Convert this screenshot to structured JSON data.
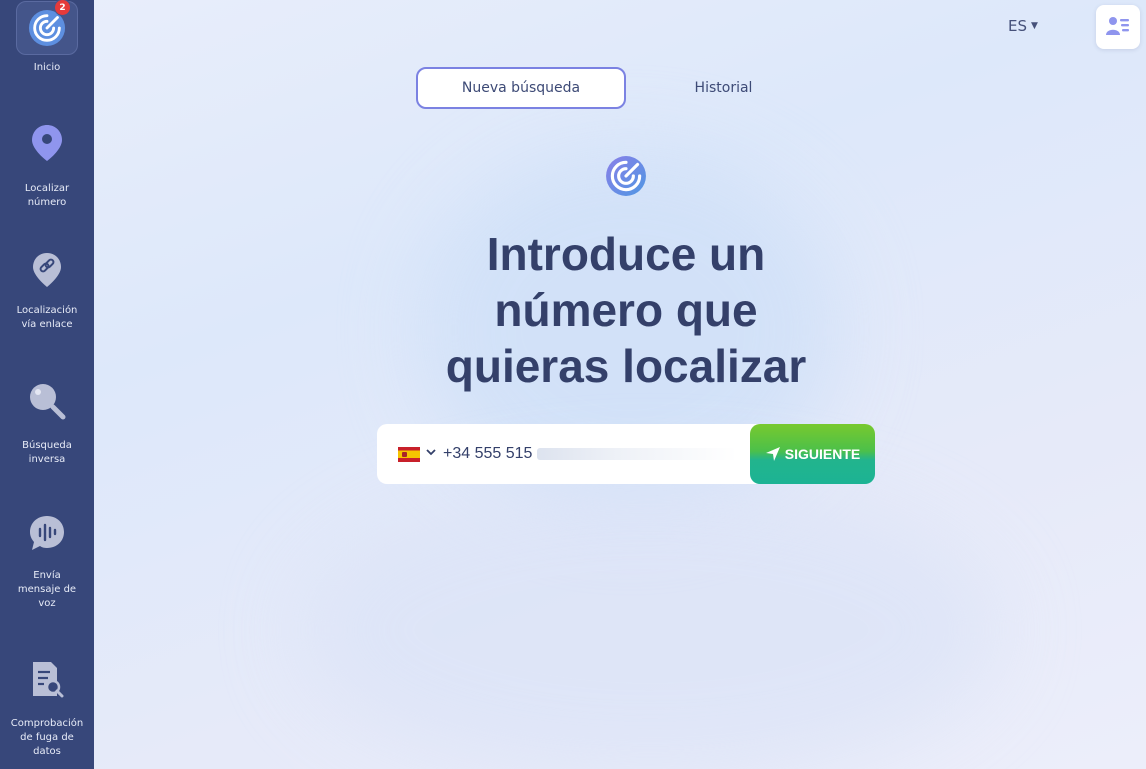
{
  "sidebar": {
    "home": {
      "label": "Inicio",
      "badge": "2"
    },
    "items": [
      {
        "label_lines": [
          "Localizar",
          "número"
        ],
        "icon": "location-pin-icon"
      },
      {
        "label_lines": [
          "Localización",
          "vía enlace"
        ],
        "icon": "link-pin-icon"
      },
      {
        "label_lines": [
          "Búsqueda",
          "inversa"
        ],
        "icon": "magnifier-icon"
      },
      {
        "label_lines": [
          "Envía",
          "mensaje de",
          "voz"
        ],
        "icon": "voice-message-icon"
      },
      {
        "label_lines": [
          "Comprobación",
          "de fuga de",
          "datos"
        ],
        "icon": "data-leak-check-icon"
      }
    ]
  },
  "header": {
    "language": "ES",
    "tabs": [
      {
        "label": "Nueva búsqueda",
        "active": true
      },
      {
        "label": "Historial",
        "active": false
      }
    ]
  },
  "main": {
    "headline_lines": [
      "Introduce un",
      "número que",
      "quieras localizar"
    ],
    "phone": {
      "country": "ES",
      "value": "+34 555 515"
    },
    "submit_label": "SIGUIENTE"
  },
  "colors": {
    "sidebar": "#37477a",
    "accent": "#7b82e2",
    "button_top": "#78c92e",
    "button_bottom": "#1cb394",
    "badge": "#e53a3a"
  }
}
